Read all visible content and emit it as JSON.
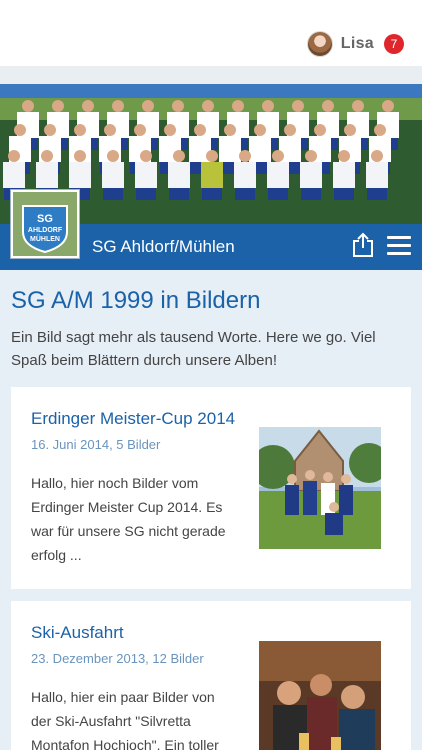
{
  "user": {
    "name": "Lisa",
    "notifications": "7"
  },
  "club": {
    "name": "SG Ahldorf/Mühlen",
    "logo_text_line1": "SG",
    "logo_text_line2": "AHLDORF",
    "logo_text_line3": "MÜHLEN"
  },
  "page": {
    "title": "SG A/M 1999 in Bildern",
    "intro": "Ein Bild sagt mehr als tausend Worte. Here we go. Viel Spaß beim Blättern durch unsere Alben!"
  },
  "albums": [
    {
      "title": "Erdinger Meister-Cup 2014",
      "meta": "16. Juni 2014, 5 Bilder",
      "text": "Hallo, hier noch Bilder vom Erdinger Meister Cup 2014. Es war für unsere SG nicht gerade erfolg ..."
    },
    {
      "title": "Ski-Ausfahrt",
      "meta": "23. Dezember 2013, 12 Bilder",
      "text": "Hallo, hier ein paar Bilder von der Ski-Ausfahrt \"Silvretta Montafon Hochjoch\". Ein toller"
    }
  ],
  "colors": {
    "brand_blue": "#1b62a8",
    "badge_red": "#e0262d",
    "page_bg": "#e6eef6"
  },
  "icons": {
    "share": "share-icon",
    "menu": "hamburger-menu-icon"
  }
}
